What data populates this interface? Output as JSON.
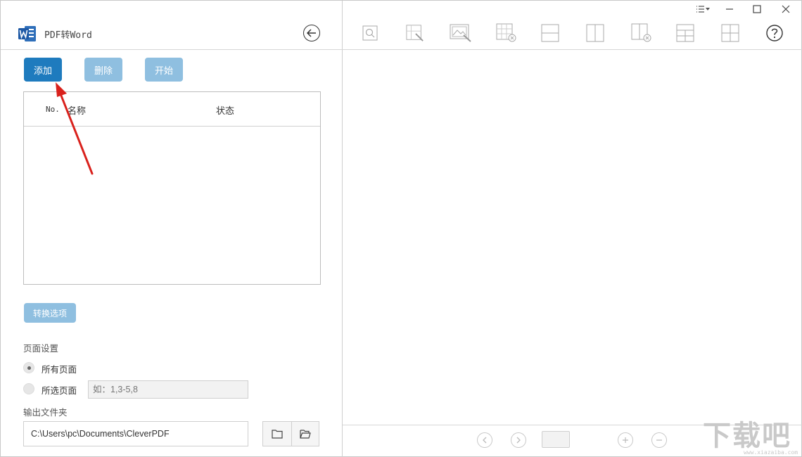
{
  "app": {
    "title": "PDF转Word"
  },
  "actions": {
    "add": "添加",
    "delete": "删除",
    "start": "开始",
    "options": "转换选项"
  },
  "table": {
    "col_no": "No.",
    "col_name": "名称",
    "col_status": "状态",
    "rows": []
  },
  "page_settings": {
    "label": "页面设置",
    "all_pages": "所有页面",
    "selected_pages": "所选页面",
    "range_placeholder": "如：1,3-5,8",
    "selected": "all_pages"
  },
  "output": {
    "label": "输出文件夹",
    "path": "C:\\Users\\pc\\Documents\\CleverPDF"
  },
  "icons": {
    "toolbar": [
      "zoom-icon",
      "edit-area-icon",
      "image-edit-icon",
      "delete-grid-icon",
      "horizontal-split-icon",
      "vertical-split-icon",
      "delete-column-icon",
      "table-layout-icon",
      "grid-layout-icon",
      "help-icon"
    ],
    "window": [
      "menu-icon",
      "minimize-icon",
      "maximize-icon",
      "close-icon"
    ]
  },
  "colors": {
    "accent": "#1e7bbe",
    "accent_disabled": "#8fbfe0",
    "arrow": "#d9211c"
  },
  "watermark": {
    "text": "下载吧",
    "url": "www.xiazaiba.com"
  }
}
